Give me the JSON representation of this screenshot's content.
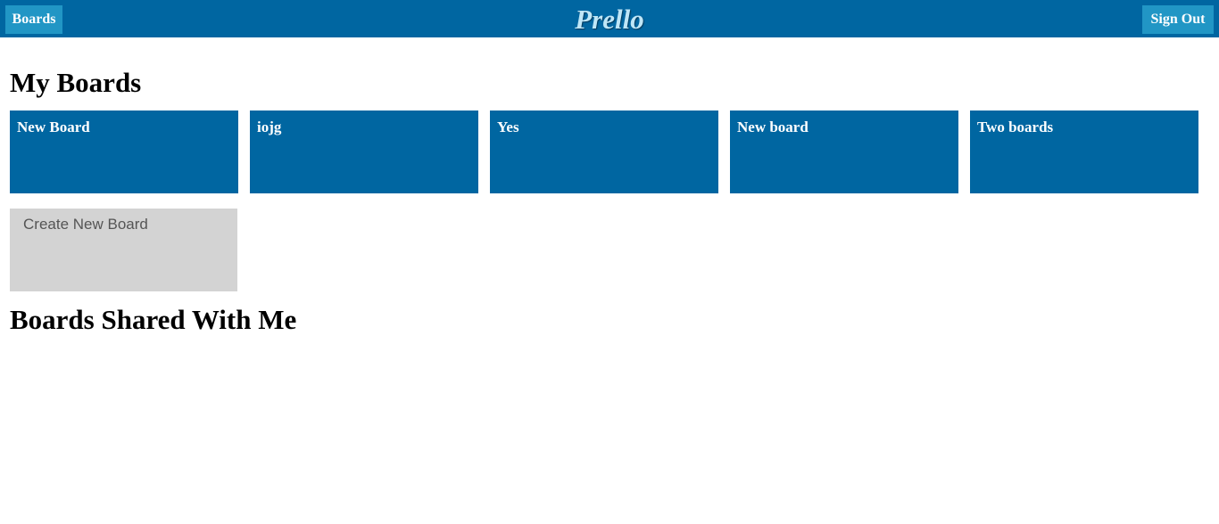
{
  "header": {
    "boards_label": "Boards",
    "logo_text": "Prello",
    "signout_label": "Sign Out"
  },
  "my_boards": {
    "title": "My Boards",
    "boards": [
      {
        "name": "New Board"
      },
      {
        "name": "iojg"
      },
      {
        "name": "Yes"
      },
      {
        "name": "New board"
      },
      {
        "name": "Two boards"
      }
    ],
    "create_label": "Create New Board"
  },
  "shared_boards": {
    "title": "Boards Shared With Me",
    "boards": []
  },
  "colors": {
    "brand": "#0066a1",
    "nav_button": "#2196c5",
    "create_tile": "#d3d3d3",
    "logo": "#bfe6f7"
  }
}
